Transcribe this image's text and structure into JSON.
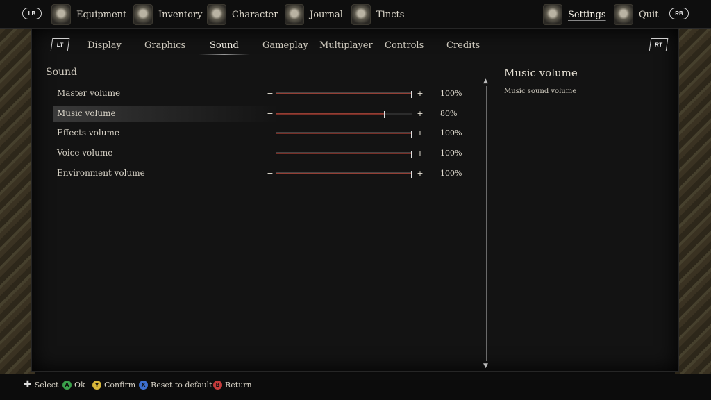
{
  "topnav": {
    "left_bumper": "LB",
    "right_bumper": "RB",
    "items": [
      {
        "label": "Equipment",
        "icon": "equipment-icon"
      },
      {
        "label": "Inventory",
        "icon": "inventory-icon"
      },
      {
        "label": "Character",
        "icon": "character-icon"
      },
      {
        "label": "Journal",
        "icon": "journal-icon"
      },
      {
        "label": "Tincts",
        "icon": "tincts-icon"
      },
      {
        "label": "Settings",
        "icon": "settings-icon",
        "active": true
      },
      {
        "label": "Quit",
        "icon": "quit-icon"
      }
    ]
  },
  "subtabs": {
    "left_trigger": "LT",
    "right_trigger": "RT",
    "items": [
      "Display",
      "Graphics",
      "Sound",
      "Gameplay",
      "Multiplayer",
      "Controls",
      "Credits"
    ],
    "active": "Sound"
  },
  "section": {
    "title": "Sound",
    "rows": [
      {
        "label": "Master volume",
        "value": 100,
        "value_text": "100%"
      },
      {
        "label": "Music volume",
        "value": 80,
        "value_text": "80%",
        "selected": true
      },
      {
        "label": "Effects volume",
        "value": 100,
        "value_text": "100%"
      },
      {
        "label": "Voice volume",
        "value": 100,
        "value_text": "100%"
      },
      {
        "label": "Environment volume",
        "value": 100,
        "value_text": "100%"
      }
    ]
  },
  "description": {
    "title": "Music volume",
    "text": "Music sound volume"
  },
  "hints": [
    {
      "button": "dpad",
      "label": "Select"
    },
    {
      "button": "A",
      "color": "#3aa04a",
      "label": "Ok"
    },
    {
      "button": "Y",
      "color": "#d8b73a",
      "label": "Confirm"
    },
    {
      "button": "X",
      "color": "#3c6fd0",
      "label": "Reset to default"
    },
    {
      "button": "B",
      "color": "#c43a3a",
      "label": "Return"
    }
  ],
  "colors": {
    "accent_fill": "#a2453a",
    "background": "#131313"
  }
}
